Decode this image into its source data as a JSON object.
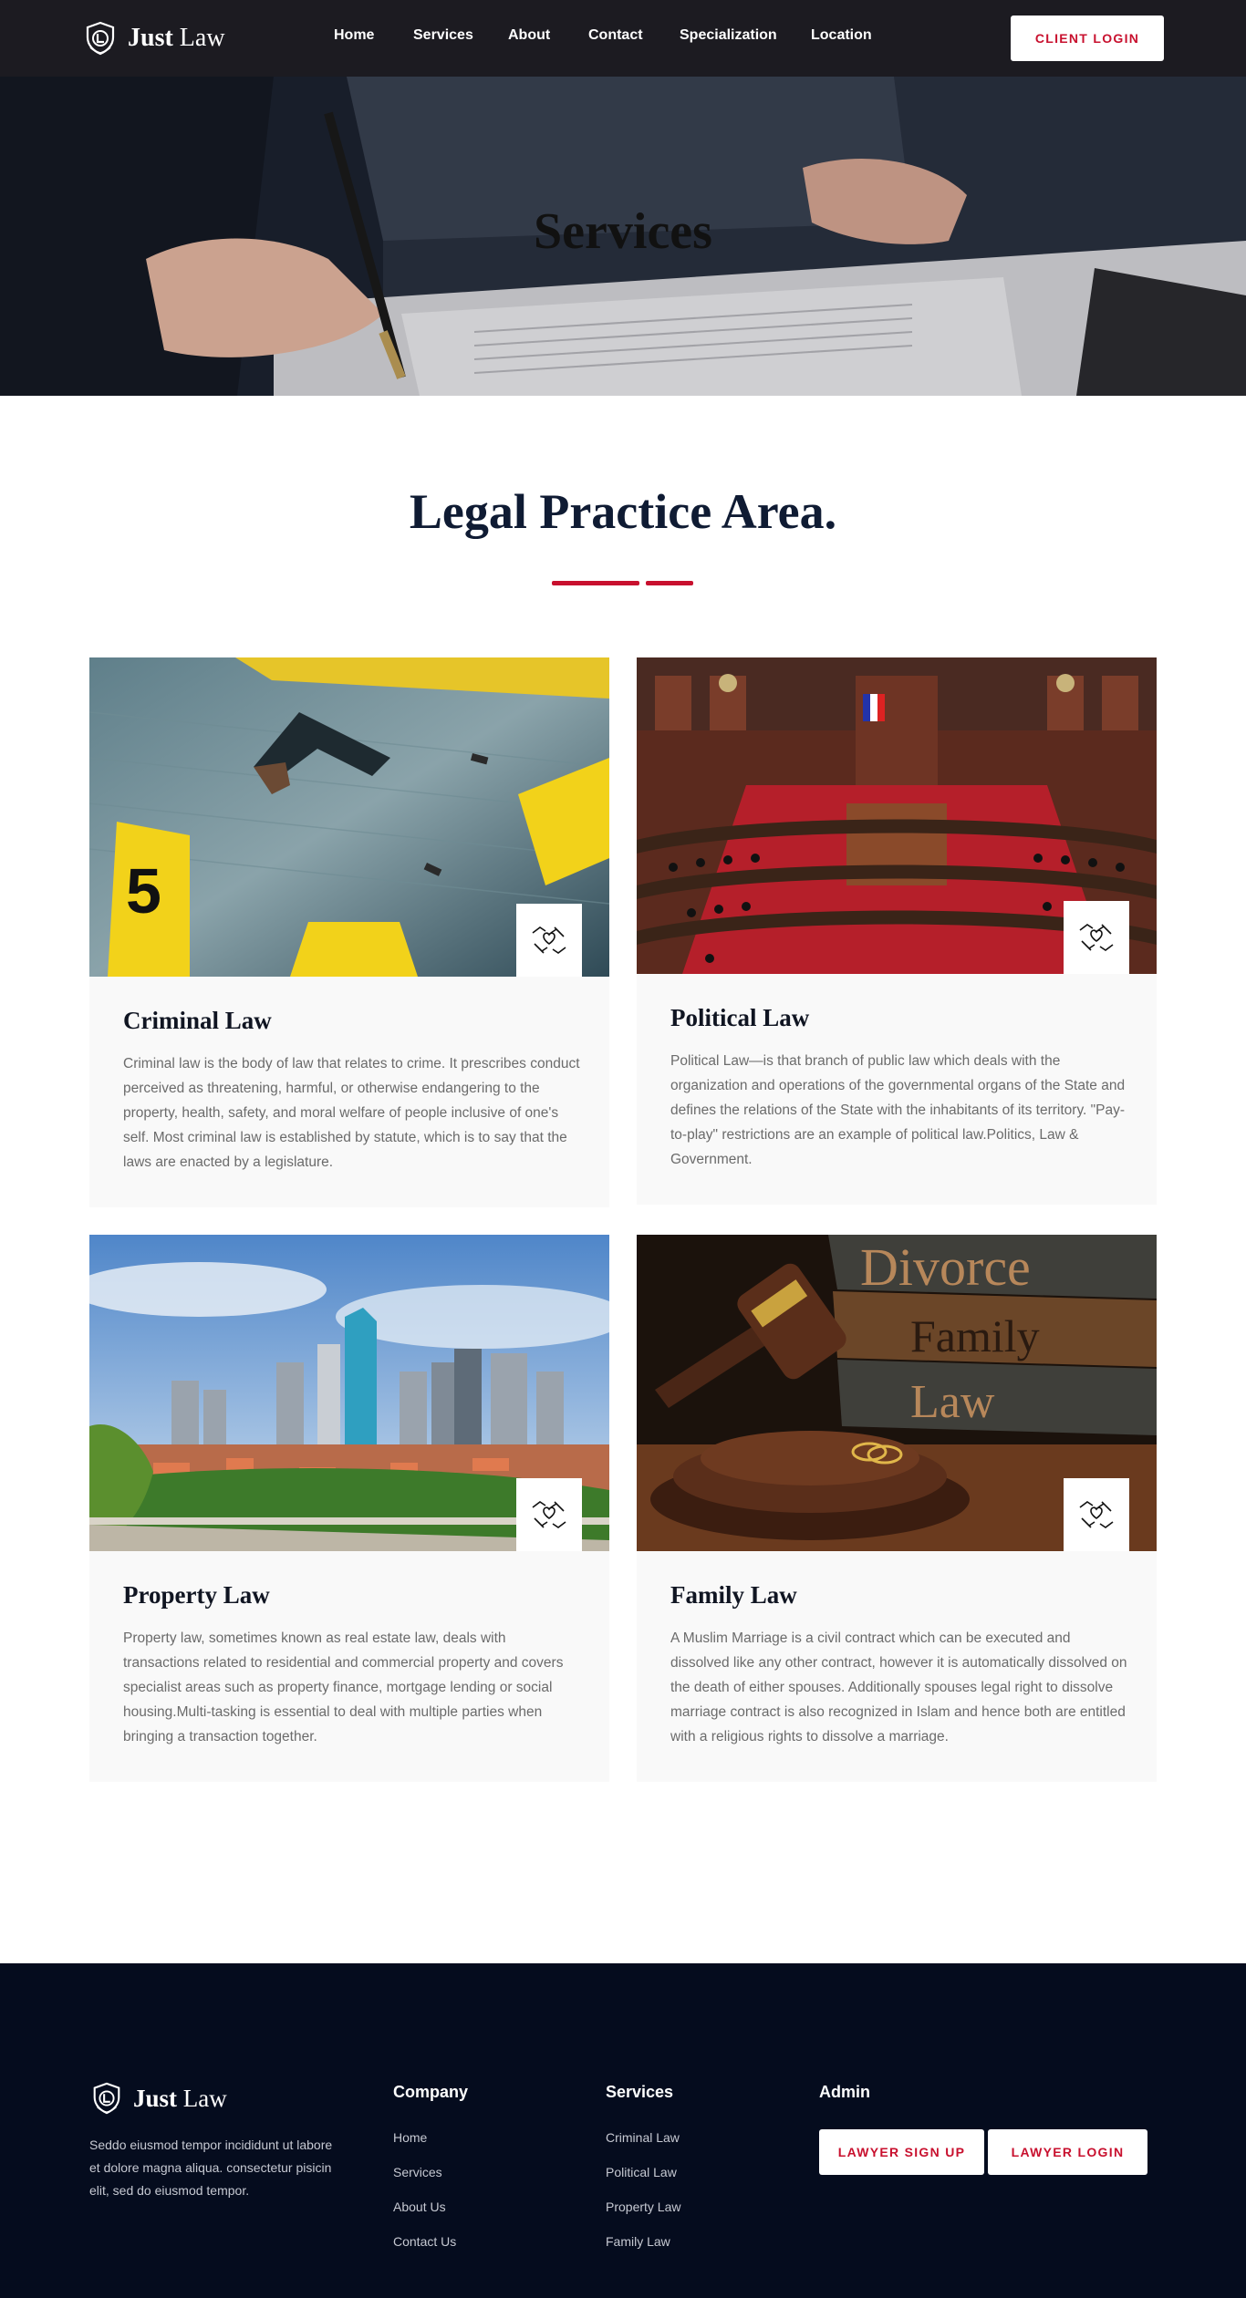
{
  "header": {
    "brand_bold": "Just",
    "brand_light": "Law",
    "nav": [
      "Home",
      "Services",
      "About",
      "Contact",
      "Specialization",
      "Location"
    ],
    "login_label": "CLIENT LOGIN",
    "bg_color": "#1c1b21"
  },
  "hero": {
    "title": "Services"
  },
  "section": {
    "title": "Legal Practice Area.",
    "accent_color": "#c8102e"
  },
  "cards": [
    {
      "title": "Criminal Law",
      "text": "Criminal law is the body of law that relates to crime. It prescribes conduct perceived as threatening, harmful, or otherwise endangering to the property, health, safety, and moral welfare of people inclusive of one's self. Most criminal law is established by statute, which is to say that the laws are enacted by a legislature.",
      "image": "crime-scene-revolver-photo",
      "icon": "handshake-heart-icon"
    },
    {
      "title": "Political Law",
      "text": "Political Law—is that branch of public law which deals with the organization and operations of the governmental organs of the State and defines the relations of the State with the inhabitants of its territory. \"Pay-to-play\" restrictions are an example of political law.Politics, Law & Government.",
      "image": "parliament-chamber-photo",
      "icon": "handshake-heart-icon"
    },
    {
      "title": "Property Law",
      "text": "Property law, sometimes known as real estate law, deals with transactions related to residential and commercial property and covers specialist areas such as property finance, mortgage lending or social housing.Multi-tasking is essential to deal with multiple parties when bringing a transaction together.",
      "image": "city-skyline-photo",
      "icon": "handshake-heart-icon"
    },
    {
      "title": "Family Law",
      "text": "A Muslim Marriage is a civil contract which can be executed and dissolved like any other contract, however it is automatically dissolved on the death of either spouses. Additionally spouses legal right to dissolve marriage contract is also recognized in Islam and hence both are entitled with a religious rights to dissolve a marriage.",
      "image": "gavel-divorce-books-photo",
      "image_text": [
        "Divorce",
        "Family",
        "Law"
      ],
      "icon": "handshake-heart-icon"
    }
  ],
  "footer": {
    "brand_bold": "Just",
    "brand_light": "Law",
    "about": "Seddo eiusmod tempor incididunt ut labore et dolore magna aliqua. consectetur pisicin elit, sed do eiusmod tempor.",
    "company_title": "Company",
    "company_links": [
      "Home",
      "Services",
      "About Us",
      "Contact Us"
    ],
    "services_title": "Services",
    "services_links": [
      "Criminal Law",
      "Political Law",
      "Property Law",
      "Family Law"
    ],
    "admin_title": "Admin",
    "signup_label": "LAWYER SIGN UP",
    "lawyer_login_label": "LAWYER LOGIN",
    "bg_color": "#050c1e"
  }
}
